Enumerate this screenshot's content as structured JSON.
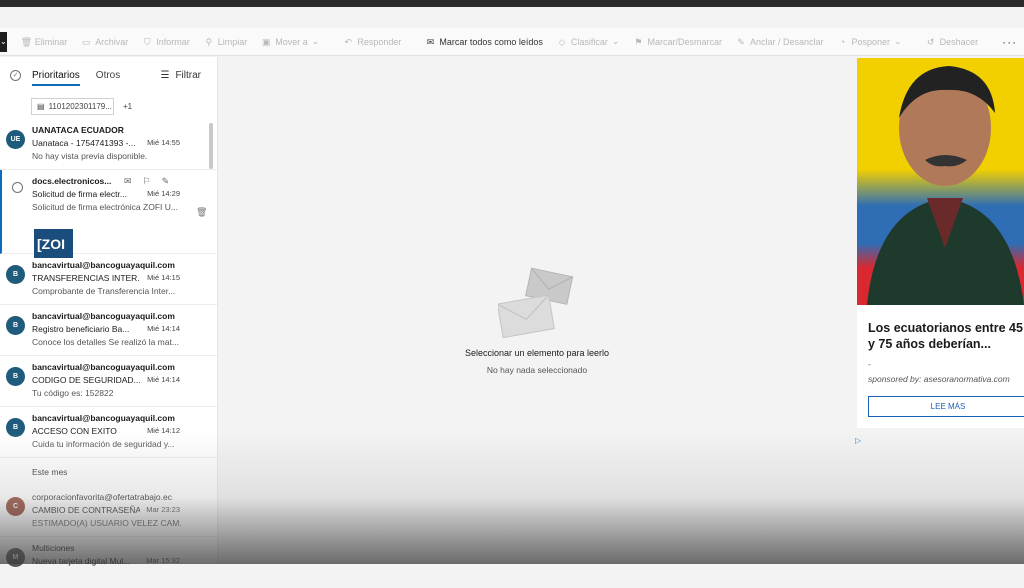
{
  "toolbar": {
    "items": [
      {
        "label": "Eliminar",
        "icon": "trash-icon"
      },
      {
        "label": "Archivar",
        "icon": "archive-icon"
      },
      {
        "label": "Informar",
        "icon": "shield-icon"
      },
      {
        "label": "Limpiar",
        "icon": "broom-icon"
      },
      {
        "label": "Mover a",
        "icon": "folder-move-icon"
      },
      {
        "label": "Responder",
        "icon": "reply-icon"
      },
      {
        "label": "Marcar todos como leídos",
        "icon": "mail-open-icon"
      },
      {
        "label": "Clasificar",
        "icon": "tag-icon"
      },
      {
        "label": "Marcar/Desmarcar",
        "icon": "flag-icon"
      },
      {
        "label": "Anclar / Desanclar",
        "icon": "pin-icon"
      },
      {
        "label": "Posponer",
        "icon": "clock-icon"
      },
      {
        "label": "Deshacer",
        "icon": "undo-icon"
      }
    ],
    "more_label": "···"
  },
  "list": {
    "tabs": {
      "focused": "Prioritarios",
      "other": "Otros"
    },
    "filter_label": "Filtrar",
    "attachment": {
      "name": "1101202301179...",
      "extra": "+1"
    },
    "mails": [
      {
        "initials": "UE",
        "color": "#1f5b7a",
        "from": "UANATACA ECUADOR",
        "subject": "Uanataca - 1754741393 -...",
        "time": "Mié 14:55",
        "preview": "No hay vista previa disponible."
      },
      {
        "initials": "",
        "color": "",
        "from": "docs.electronicos...",
        "subject": "Solicitud de firma electr...",
        "time": "Mié 14:29",
        "preview": "Solicitud de firma electrónica ZOFI U...",
        "thumb": "[ZOI"
      },
      {
        "initials": "B",
        "color": "#1f5b7a",
        "from": "bancavirtual@bancoguayaquil.com",
        "subject": "TRANSFERENCIAS INTER...",
        "time": "Mié 14:15",
        "preview": "Comprobante de Transferencia Inter..."
      },
      {
        "initials": "B",
        "color": "#1f5b7a",
        "from": "bancavirtual@bancoguayaquil.com",
        "subject": "Registro beneficiario Ba...",
        "time": "Mié 14:14",
        "preview": "Conoce los detalles Se realizó la mat..."
      },
      {
        "initials": "B",
        "color": "#1f5b7a",
        "from": "bancavirtual@bancoguayaquil.com",
        "subject": "CODIGO DE SEGURIDAD...",
        "time": "Mié 14:14",
        "preview": "Tu código es: 152822"
      },
      {
        "initials": "B",
        "color": "#1f5b7a",
        "from": "bancavirtual@bancoguayaquil.com",
        "subject": "ACCESO CON EXITO",
        "time": "Mié 14:12",
        "preview": "Cuida tu información de seguridad y..."
      }
    ],
    "group_label": "Este mes",
    "older": [
      {
        "initials": "C",
        "color": "#8a3b2a",
        "from": "corporacionfavorita@ofertatrabajo.ec",
        "subject": "CAMBIO DE CONTRASEÑA",
        "time": "Mar 23:23",
        "preview": "ESTIMADO(A) USUARIO VELEZ CAM..."
      },
      {
        "initials": "M",
        "color": "#555555",
        "from": "Multiciones",
        "subject": "Nueva tarjeta digital Mul...",
        "time": "Mar 15:32",
        "preview": ""
      }
    ]
  },
  "reading": {
    "title": "Seleccionar un elemento para leerlo",
    "subtitle": "No hay nada seleccionado"
  },
  "ad": {
    "title": "Los ecuatorianos entre 45 y 75 años deberían...",
    "dash": "-",
    "sponsored": "sponsored by: asesoranormativa.com",
    "button": "LEE MÁS",
    "adchoices": "▷"
  }
}
